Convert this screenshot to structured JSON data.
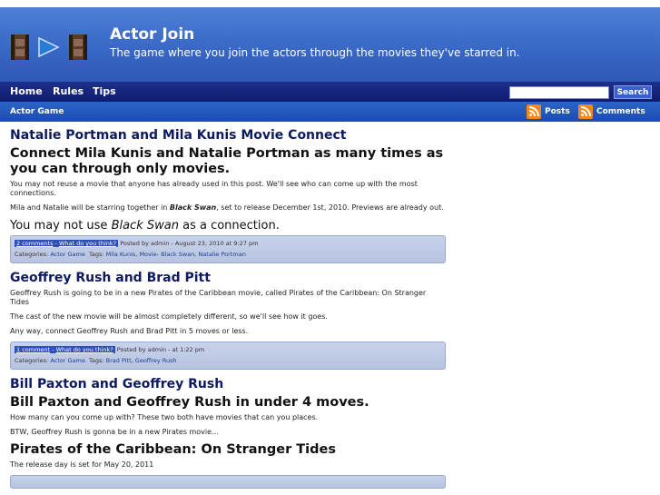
{
  "site": {
    "title": "Actor Join",
    "tagline": "The game where you join the actors through the movies they've starred in."
  },
  "nav": {
    "home": "Home",
    "rules": "Rules",
    "tips": "Tips"
  },
  "search": {
    "button": "Search",
    "placeholder": ""
  },
  "subbar": {
    "category": "Actor Game",
    "posts_feed": "Posts",
    "comments_feed": "Comments"
  },
  "posts": [
    {
      "title": "Natalie Portman and Mila Kunis Movie Connect",
      "headline": "Connect Mila Kunis and Natalie Portman as many times as you can through only movies.",
      "p1": "You may not reuse a movie that anyone has already used in this post.  We'll see who can come up with the most connections.",
      "p2_a": "Mila and Natalie will be starring together in ",
      "p2_movie": "Black Swan",
      "p2_b": ", set to release December 1st, 2010.  Previews are already out.",
      "sub_a": "You may not use ",
      "sub_movie": "Black Swan",
      "sub_b": " as a connection.",
      "comments": "2 comments",
      "what": "What do you think?",
      "posted": "Posted by admin - August 23, 2010 at 9:27 pm",
      "categories_label": "Categories:",
      "category": "Actor Game",
      "tags_label": "Tags:",
      "tag1": "Mila Kunis",
      "tag2": "Movie- Black Swan",
      "tag3": "Natalie Portman"
    },
    {
      "title": "Geoffrey Rush and Brad Pitt",
      "p1": "Geoffrey Rush is going to be in a new Pirates of the Caribbean movie, called Pirates of the Caribbean: On Stranger Tides",
      "p2": "The cast of the new movie will be almost completely different, so we'll see how it goes.",
      "p3": "Any way, connect Geoffrey Rush and Brad Pitt in 5 moves or less.",
      "comments": "1 comment",
      "what": "What do you think?",
      "posted": "Posted by admin - at 1:22 pm",
      "categories_label": "Categories:",
      "category": "Actor Game",
      "tags_label": "Tags:",
      "tag1": "Brad Pitt",
      "tag2": "Geoffrey Rush"
    },
    {
      "title": "Bill Paxton and Geoffrey Rush",
      "headline": "Bill Paxton and Geoffrey Rush in under 4 moves.",
      "p1": "How many can you come up with?  These two both have movies that can you places.",
      "p2": "BTW, Geoffrey Rush is gonna be in a new Pirates movie…",
      "headline2": "Pirates of the Caribbean: On Stranger Tides",
      "p3": "The release day is set for May 20, 2011"
    }
  ],
  "colors": {
    "header": "#3d6fd0",
    "navbar": "#17247a",
    "subbar": "#2559bd",
    "title": "#0d1a60",
    "meta_bg": "#c3cde8",
    "feed": "#f7861c"
  }
}
